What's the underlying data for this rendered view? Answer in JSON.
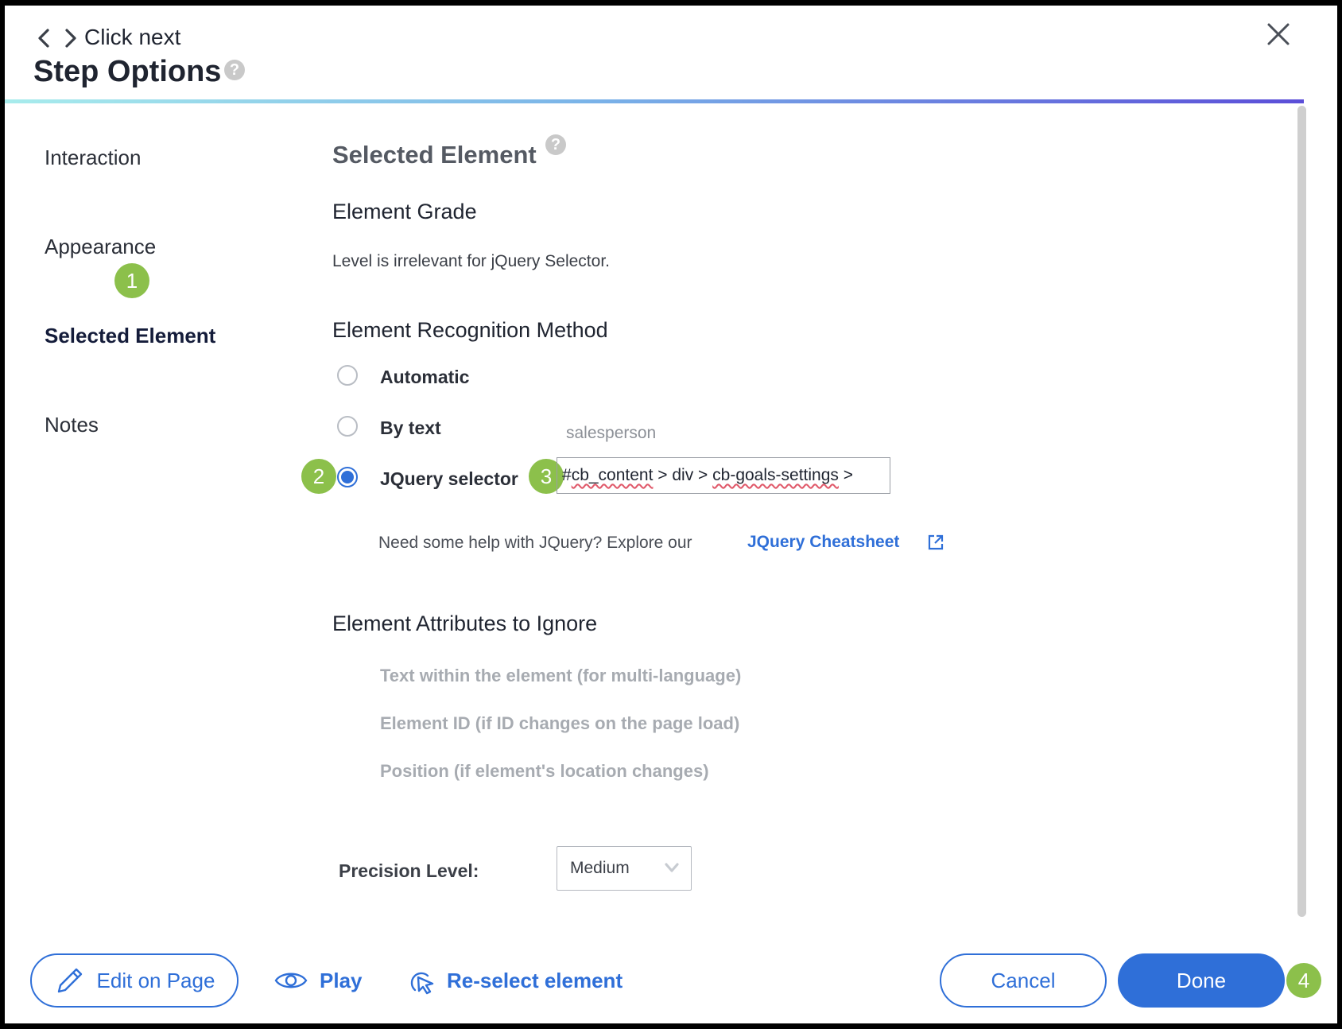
{
  "header": {
    "step_name": "Click next",
    "title": "Step Options",
    "help_glyph": "?"
  },
  "sidebar": {
    "items": [
      {
        "label": "Interaction"
      },
      {
        "label": "Appearance"
      },
      {
        "label": "Selected Element"
      },
      {
        "label": "Notes"
      }
    ]
  },
  "main": {
    "section_title": "Selected Element",
    "element_grade": {
      "heading": "Element Grade",
      "note": "Level is irrelevant for jQuery Selector."
    },
    "recognition": {
      "heading": "Element Recognition Method",
      "options": [
        {
          "label": "Automatic",
          "checked": false
        },
        {
          "label": "By text",
          "checked": false,
          "value": "salesperson"
        },
        {
          "label": "JQuery selector",
          "checked": true
        }
      ],
      "jquery_value_parts": [
        "#",
        "cb_content",
        " > div > ",
        "cb-goals-settings",
        " >"
      ],
      "help_text": "Need some help with JQuery? Explore our",
      "link_label": "JQuery Cheatsheet"
    },
    "ignore": {
      "heading": "Element Attributes to Ignore",
      "items": [
        "Text within the element (for multi-language)",
        "Element ID (if ID changes on the page load)",
        "Position (if element's location changes)"
      ]
    },
    "precision": {
      "label": "Precision Level:",
      "value": "Medium"
    }
  },
  "footer": {
    "edit_label": "Edit on Page",
    "play_label": "Play",
    "reselect_label": "Re-select element",
    "cancel_label": "Cancel",
    "done_label": "Done"
  },
  "badges": [
    "1",
    "2",
    "3",
    "4"
  ],
  "colors": {
    "accent": "#2f6fd8",
    "badge": "#8cc04b",
    "muted_text": "#a7abb1"
  },
  "icons": [
    "chevron-left-icon",
    "chevron-right-icon",
    "help-icon",
    "close-icon",
    "external-link-icon",
    "chevron-down-icon",
    "pencil-icon",
    "eye-icon",
    "cursor-select-icon"
  ]
}
